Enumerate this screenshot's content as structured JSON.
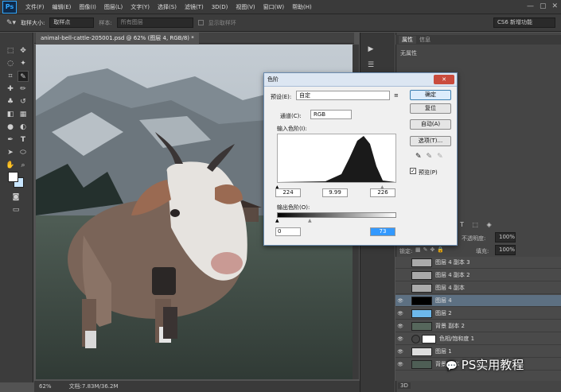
{
  "app": {
    "logo": "Ps"
  },
  "menu": [
    "文件(F)",
    "编辑(E)",
    "图像(I)",
    "图层(L)",
    "文字(Y)",
    "选择(S)",
    "滤镜(T)",
    "3D(D)",
    "视图(V)",
    "窗口(W)",
    "帮助(H)"
  ],
  "options_bar": {
    "sample_size_label": "取样大小:",
    "sample_size_value": "取样点",
    "sample_label": "样本:",
    "sample_value": "所有图层",
    "show_ring_label": "显示取样环",
    "workspace": "CS6 新增功能"
  },
  "document": {
    "tab_title": "animal-bell-cattle-205001.psd @ 62% (图层 4, RGB/8) *",
    "zoom": "62%",
    "doc_info": "文档:7.83M/36.2M"
  },
  "right_panel": {
    "tabs": [
      "属性",
      "信息"
    ],
    "no_properties": "无属性",
    "opacity_label": "不透明度:",
    "opacity_value": "100%",
    "fill_label": "填充:",
    "fill_value": "100%",
    "lock_label": "锁定:"
  },
  "layers": [
    {
      "name": "图层 4 副本 3",
      "visible": false
    },
    {
      "name": "图层 4 副本 2",
      "visible": false
    },
    {
      "name": "图层 4 副本",
      "visible": false
    },
    {
      "name": "图层 4",
      "visible": true,
      "selected": true
    },
    {
      "name": "图层 2",
      "visible": true
    },
    {
      "name": "背景 副本 2",
      "visible": true
    },
    {
      "name": "色相/饱和度 1",
      "visible": true
    },
    {
      "name": "图层 1",
      "visible": true
    },
    {
      "name": "背景 副本",
      "visible": true
    }
  ],
  "bottom_tab": "3D",
  "levels_dialog": {
    "title": "色阶",
    "preset_label": "预设(E):",
    "preset_value": "自定",
    "channel_label": "通道(C):",
    "channel_value": "RGB",
    "input_label": "输入色阶(I):",
    "input_black": "224",
    "input_gamma": "9.99",
    "input_white": "226",
    "output_label": "输出色阶(O):",
    "output_black": "0",
    "output_white": "73",
    "buttons": {
      "ok": "确定",
      "reset": "复位",
      "auto": "自动(A)",
      "options": "选项(T)..."
    },
    "preview_label": "预览(P)",
    "preview_checked": true
  },
  "watermark": "PS实用教程"
}
